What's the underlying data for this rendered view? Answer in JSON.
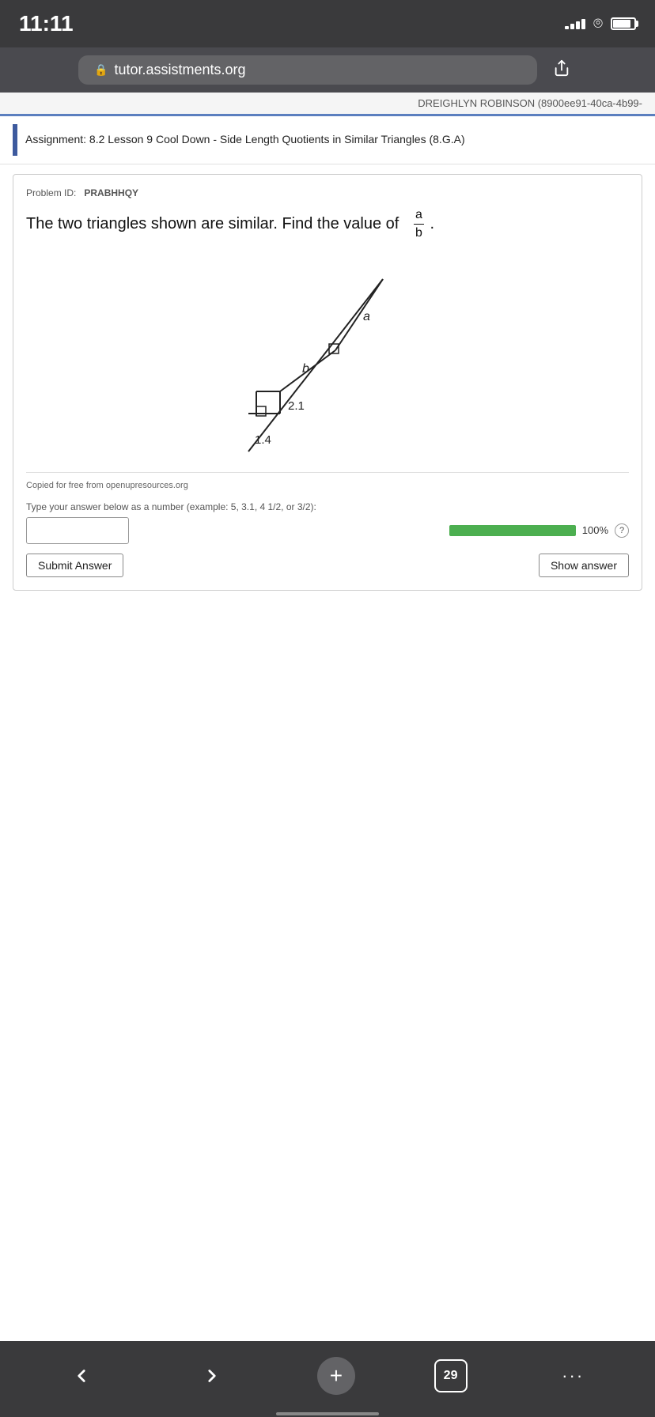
{
  "status": {
    "time": "11:11",
    "signal_bars": [
      4,
      7,
      10,
      13,
      16
    ],
    "battery_percent": 85
  },
  "browser": {
    "url": "tutor.assistments.org",
    "lock_icon": "🔒",
    "share_icon": "⬆"
  },
  "user_bar": {
    "text": "DREIGHLYN ROBINSON (8900ee91-40ca-4b99-"
  },
  "assignment": {
    "title": "Assignment: 8.2 Lesson 9 Cool Down - Side Length Quotients in Similar Triangles (8.G.A)"
  },
  "problem": {
    "id_label": "Problem ID:",
    "id_value": "PRABHHQY",
    "question_text": "The two triangles shown are similar. Find the value of",
    "fraction_numerator": "a",
    "fraction_denominator": "b",
    "question_suffix": ".",
    "diagram": {
      "labels": {
        "a": "a",
        "b": "b",
        "val1": "2.1",
        "val2": "1.4"
      }
    },
    "attribution": "Copied for free from openupresources.org",
    "answer_instruction": "Type your answer below as a number (example: 5, 3.1, 4 1/2, or 3/2):",
    "answer_placeholder": "",
    "progress_percent": "100%",
    "submit_label": "Submit Answer",
    "show_answer_label": "Show answer"
  },
  "bottom_nav": {
    "back_icon": "←",
    "forward_icon": "→",
    "add_icon": "+",
    "tab_count": "29",
    "more_icon": "···"
  }
}
